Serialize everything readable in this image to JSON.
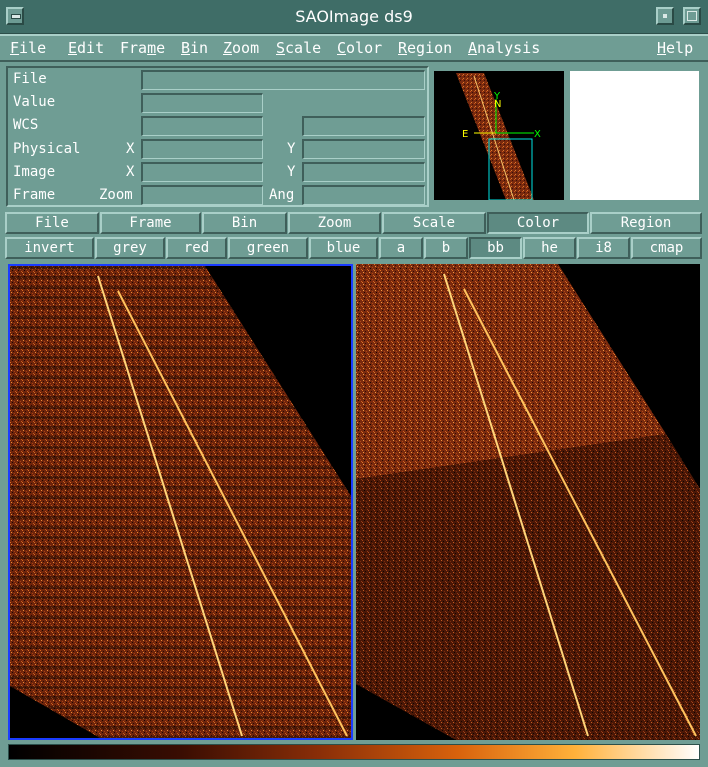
{
  "window": {
    "title": "SAOImage ds9"
  },
  "menubar": {
    "items": [
      {
        "accel": "F",
        "rest": "ile"
      },
      {
        "accel": "E",
        "rest": "dit"
      },
      {
        "accel": "",
        "pre": "Fra",
        "accel2": "m",
        "rest": "e"
      },
      {
        "accel": "B",
        "rest": "in"
      },
      {
        "accel": "Z",
        "rest": "oom"
      },
      {
        "accel": "S",
        "rest": "cale"
      },
      {
        "accel": "C",
        "rest": "olor"
      },
      {
        "accel": "R",
        "rest": "egion"
      },
      {
        "accel": "A",
        "rest": "nalysis"
      },
      {
        "accel": "H",
        "rest": "elp"
      }
    ]
  },
  "info": {
    "labels": {
      "file": "File",
      "value": "Value",
      "wcs": "WCS",
      "physical": "Physical",
      "image": "Image",
      "frame": "Frame"
    },
    "sublabels": {
      "physical_x": "X",
      "physical_y": "Y",
      "image_x": "X",
      "image_y": "Y",
      "zoom": "Zoom",
      "ang": "Ang"
    },
    "values": {
      "file": "",
      "value": "",
      "wcs_1": "",
      "wcs_2": "",
      "physical_x": "",
      "physical_y": "",
      "image_x": "",
      "image_y": "",
      "zoom": "",
      "ang": ""
    }
  },
  "panner": {
    "compass_north": "N",
    "compass_east": "E",
    "axis_x": "X",
    "axis_y": "Y"
  },
  "buttonbar": {
    "categories": [
      "File",
      "Frame",
      "Bin",
      "Zoom",
      "Scale",
      "Color",
      "Region"
    ],
    "active_category": "Color",
    "colormaps": [
      "invert",
      "grey",
      "red",
      "green",
      "blue",
      "a",
      "b",
      "bb",
      "he",
      "i8",
      "cmap"
    ],
    "active_colormap": "bb"
  },
  "colors": {
    "bg": "#6f9d94",
    "title_bg": "#3f6d67",
    "frame_highlight": "#1a3cff",
    "compass": "#ffff00",
    "axes": "#00ff00",
    "panner_box": "#00e5e5"
  },
  "colorbar": {
    "colormap": "bb"
  }
}
